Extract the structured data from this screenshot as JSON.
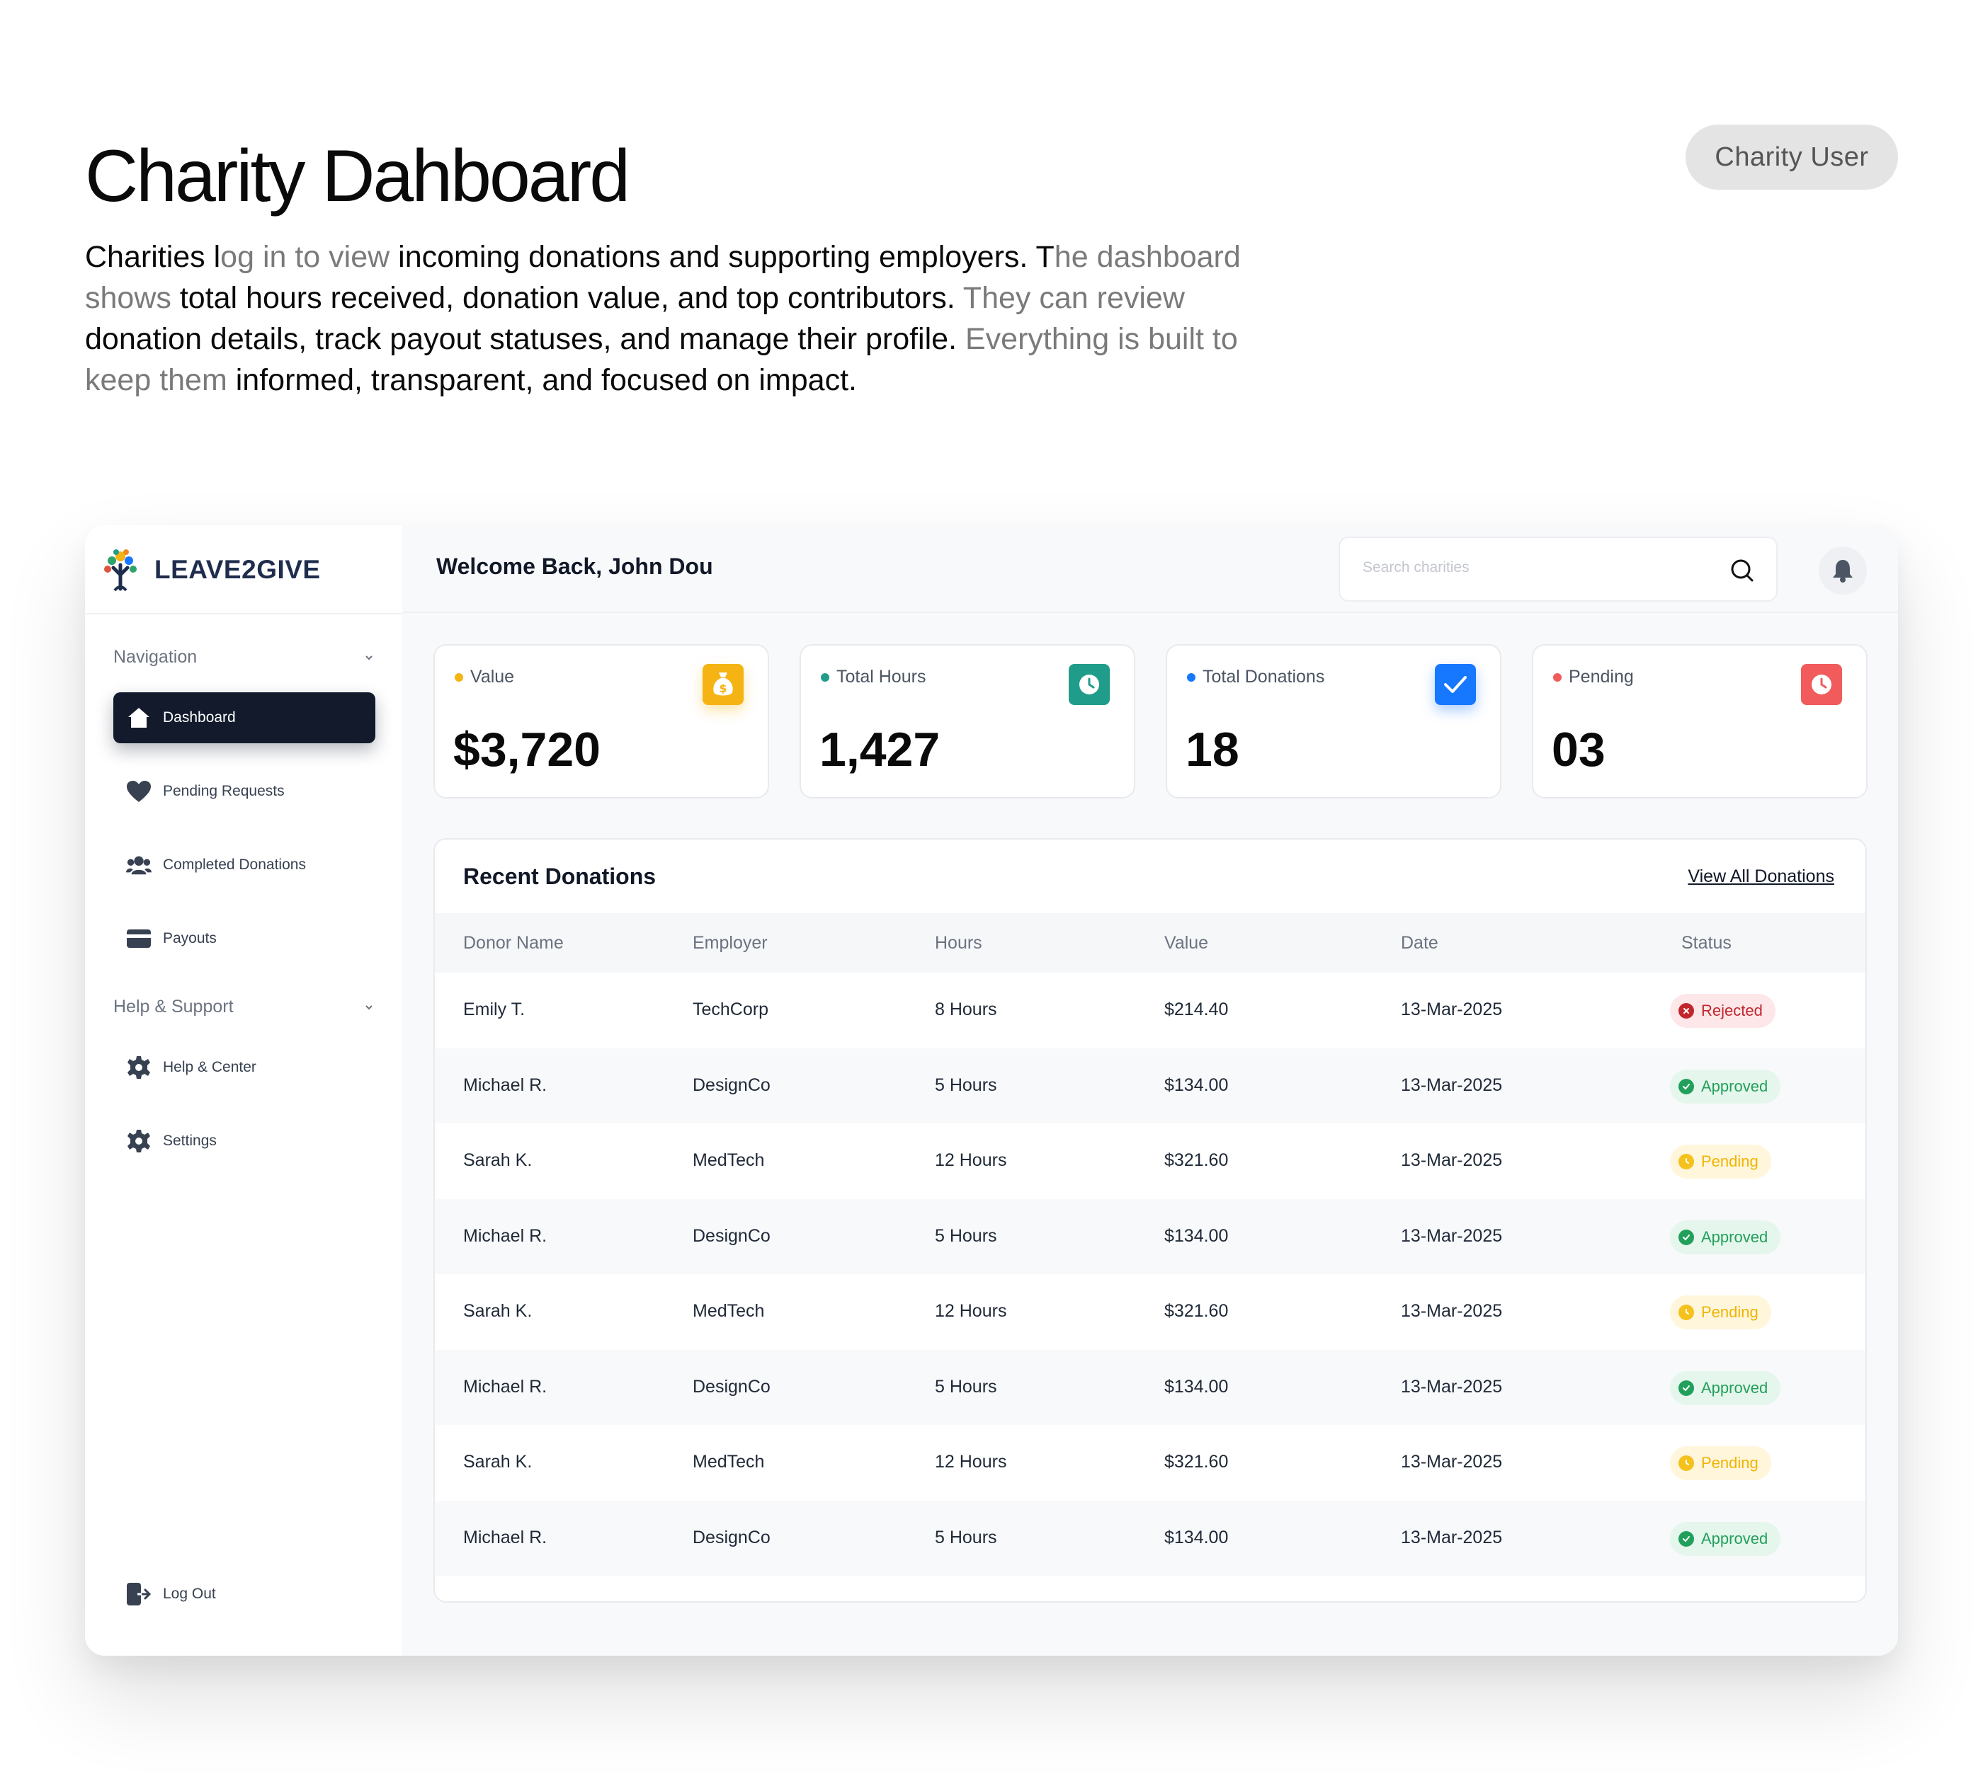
{
  "hero": {
    "title": "Charity Dahboard",
    "desc_parts": [
      {
        "t": "Charities l",
        "muted": false
      },
      {
        "t": "og in to view",
        "muted": true
      },
      {
        "t": " incoming donations and supporting employers. T",
        "muted": false
      },
      {
        "t": "he dashboard shows",
        "muted": true
      },
      {
        "t": " total hours received, donation value, and top contributors.",
        "muted": false
      },
      {
        "t": " They can review",
        "muted": true
      },
      {
        "t": " donation details, track payout statuses, and manage their profile.",
        "muted": false
      },
      {
        "t": " Everything is built to keep them",
        "muted": true
      },
      {
        "t": " informed, transparent, and focused on impact.",
        "muted": false
      }
    ],
    "user_chip": "Charity User"
  },
  "app": {
    "logo": "LEAVE2GIVE",
    "welcome": "Welcome Back, John Dou",
    "search_placeholder": "Search charities",
    "sidebar": {
      "nav_label": "Navigation",
      "help_label": "Help & Support",
      "items": [
        "Dashboard",
        "Pending Requests",
        "Completed Donations",
        "Payouts"
      ],
      "help_items": [
        "Help & Center",
        "Settings"
      ],
      "logout": "Log Out"
    },
    "stats": [
      {
        "label": "Value",
        "value": "$3,720",
        "color": "#f5b414"
      },
      {
        "label": "Total Hours",
        "value": "1,427",
        "color": "#1f9d8a"
      },
      {
        "label": "Total Donations",
        "value": "18",
        "color": "#1677ff"
      },
      {
        "label": "Pending",
        "value": "03",
        "color": "#f15b5b"
      }
    ],
    "table": {
      "title": "Recent Donations",
      "view_all": "View All Donations",
      "columns": [
        "Donor Name",
        "Employer",
        "Hours",
        "Value",
        "Date",
        "Status"
      ],
      "rows": [
        {
          "donor": "Emily T.",
          "employer": "TechCorp",
          "hours": "8 Hours",
          "value": "$214.40",
          "date": "13-Mar-2025",
          "status": "Rejected"
        },
        {
          "donor": "Michael R.",
          "employer": "DesignCo",
          "hours": "5 Hours",
          "value": "$134.00",
          "date": "13-Mar-2025",
          "status": "Approved"
        },
        {
          "donor": "Sarah K.",
          "employer": "MedTech",
          "hours": "12 Hours",
          "value": "$321.60",
          "date": "13-Mar-2025",
          "status": "Pending"
        },
        {
          "donor": "Michael R.",
          "employer": "DesignCo",
          "hours": "5 Hours",
          "value": "$134.00",
          "date": "13-Mar-2025",
          "status": "Approved"
        },
        {
          "donor": "Sarah K.",
          "employer": "MedTech",
          "hours": "12 Hours",
          "value": "$321.60",
          "date": "13-Mar-2025",
          "status": "Pending"
        },
        {
          "donor": "Michael R.",
          "employer": "DesignCo",
          "hours": "5 Hours",
          "value": "$134.00",
          "date": "13-Mar-2025",
          "status": "Approved"
        },
        {
          "donor": "Sarah K.",
          "employer": "MedTech",
          "hours": "12 Hours",
          "value": "$321.60",
          "date": "13-Mar-2025",
          "status": "Pending"
        },
        {
          "donor": "Michael R.",
          "employer": "DesignCo",
          "hours": "5 Hours",
          "value": "$134.00",
          "date": "13-Mar-2025",
          "status": "Approved"
        }
      ]
    }
  }
}
